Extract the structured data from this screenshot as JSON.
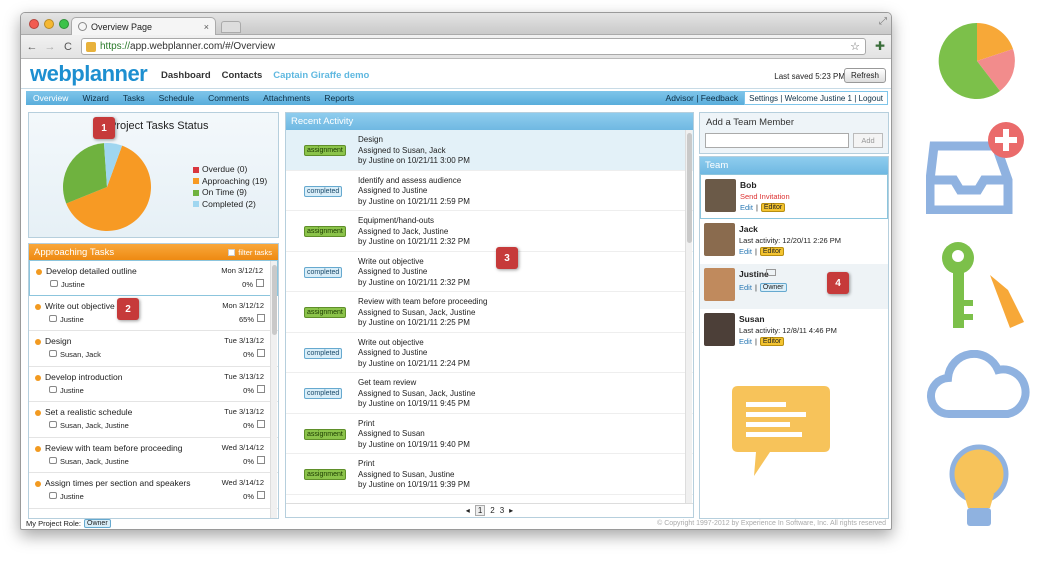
{
  "browser": {
    "tab_title": "Overview Page",
    "url_https": "https://",
    "url_rest": "app.webplanner.com/#/Overview"
  },
  "app": {
    "logo": "webplanner",
    "nav": [
      "Dashboard",
      "Contacts"
    ],
    "demo": "Captain Giraffe demo",
    "saved": "Last saved 5:23 PM",
    "refresh": "Refresh"
  },
  "menu": {
    "items": [
      "Overview",
      "Wizard",
      "Tasks",
      "Schedule",
      "Comments",
      "Attachments",
      "Reports"
    ],
    "advisor": "Advisor | Feedback",
    "settings": "Settings | Welcome Justine 1 | Logout"
  },
  "status": {
    "title": "Project Tasks Status",
    "legend": [
      {
        "label": "Overdue (0)",
        "color": "#d9363e"
      },
      {
        "label": "Approaching (19)",
        "color": "#f79a24"
      },
      {
        "label": "On Time (9)",
        "color": "#6fb23f"
      },
      {
        "label": "Completed (2)",
        "color": "#9fd6f0"
      }
    ]
  },
  "chart_data": {
    "type": "pie",
    "title": "Project Tasks Status",
    "categories": [
      "Overdue",
      "Approaching",
      "On Time",
      "Completed"
    ],
    "values": [
      0,
      19,
      9,
      2
    ],
    "legend": "right"
  },
  "badges": [
    "1",
    "2",
    "3",
    "4"
  ],
  "approaching": {
    "title": "Approaching Tasks",
    "filter": "filter tasks",
    "tasks": [
      {
        "name": "Develop detailed outline",
        "date": "Mon 3/12/12",
        "assignee": "Justine",
        "pct": "0%"
      },
      {
        "name": "Write out objective",
        "date": "Mon 3/12/12",
        "assignee": "Justine",
        "pct": "65%"
      },
      {
        "name": "Design",
        "date": "Tue 3/13/12",
        "assignee": "Susan, Jack",
        "pct": "0%"
      },
      {
        "name": "Develop introduction",
        "date": "Tue 3/13/12",
        "assignee": "Justine",
        "pct": "0%"
      },
      {
        "name": "Set a realistic schedule",
        "date": "Tue 3/13/12",
        "assignee": "Susan, Jack, Justine",
        "pct": "0%"
      },
      {
        "name": "Review with team before proceeding",
        "date": "Wed 3/14/12",
        "assignee": "Susan, Jack, Justine",
        "pct": "0%"
      },
      {
        "name": "Assign times per section and speakers",
        "date": "Wed 3/14/12",
        "assignee": "Justine",
        "pct": "0%"
      }
    ]
  },
  "activity": {
    "title": "Recent Activity",
    "rows": [
      {
        "tag": "assignment",
        "l1": "Design",
        "l2": "Assigned to Susan, Jack",
        "l3": "by Justine on 10/21/11 3:00 PM"
      },
      {
        "tag": "completed",
        "l1": "Identify and assess audience",
        "l2": "Assigned to Justine",
        "l3": "by Justine on 10/21/11 2:59 PM"
      },
      {
        "tag": "assignment",
        "l1": "Equipment/hand-outs",
        "l2": "Assigned to Jack, Justine",
        "l3": "by Justine on 10/21/11 2:32 PM"
      },
      {
        "tag": "completed",
        "l1": "Write out objective",
        "l2": "Assigned to Justine",
        "l3": "by Justine on 10/21/11 2:32 PM"
      },
      {
        "tag": "assignment",
        "l1": "Review with team before proceeding",
        "l2": "Assigned to Susan, Jack, Justine",
        "l3": "by Justine on 10/21/11 2:25 PM"
      },
      {
        "tag": "completed",
        "l1": "Write out objective",
        "l2": "Assigned to Justine",
        "l3": "by Justine on 10/21/11 2:24 PM"
      },
      {
        "tag": "completed",
        "l1": "Get team review",
        "l2": "Assigned to Susan, Jack, Justine",
        "l3": "by Justine on 10/19/11 9:45 PM"
      },
      {
        "tag": "assignment",
        "l1": "Print",
        "l2": "Assigned to Susan",
        "l3": "by Justine on 10/19/11 9:40 PM"
      },
      {
        "tag": "assignment",
        "l1": "Print",
        "l2": "Assigned to Susan, Justine",
        "l3": "by Justine on 10/19/11 9:39 PM"
      }
    ],
    "pages": [
      "1",
      "2",
      "3"
    ]
  },
  "add_member": {
    "title": "Add a Team Member",
    "button": "Add"
  },
  "team": {
    "title": "Team",
    "edit": "Edit",
    "members": [
      {
        "name": "Bob",
        "line2": "Send Invitation",
        "role": "Editor",
        "roleClass": "editor",
        "avatar": "#6b5a48"
      },
      {
        "name": "Jack",
        "line2": "Last activity: 12/20/11 2:26 PM",
        "role": "Editor",
        "roleClass": "editor",
        "avatar": "#8a6b4e"
      },
      {
        "name": "Justine",
        "line2": "",
        "role": "Owner",
        "roleClass": "owner",
        "avatar": "#c08a5d"
      },
      {
        "name": "Susan",
        "line2": "Last activity: 12/8/11 4:46 PM",
        "role": "Editor",
        "roleClass": "editor",
        "avatar": "#4c3f38"
      }
    ]
  },
  "footer": {
    "label": "My Project Role:",
    "role": "Owner",
    "copyright": "© Copyright 1997-2012 by Experience In Software, Inc. All rights reserved"
  }
}
